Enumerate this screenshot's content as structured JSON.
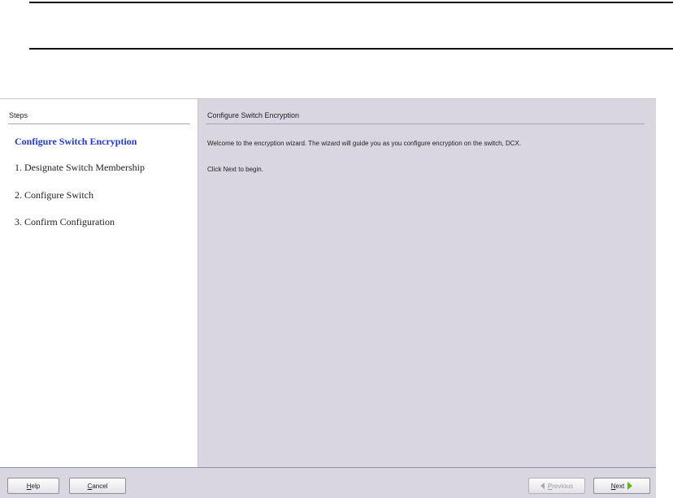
{
  "wizard": {
    "steps_header": "Steps",
    "steps": [
      "Configure Switch Encryption",
      "1. Designate Switch Membership",
      "2. Configure Switch",
      "3. Confirm Configuration"
    ],
    "content_title": "Configure Switch Encryption",
    "welcome_text": "Welcome to the encryption wizard. The wizard will guide you as you configure encryption on the switch, DCX.",
    "begin_text": "Click Next to begin."
  },
  "buttons": {
    "help": {
      "mnemonic": "H",
      "rest": "elp"
    },
    "cancel": {
      "mnemonic": "C",
      "rest": "ancel"
    },
    "previous": {
      "mnemonic": "P",
      "rest": "revious"
    },
    "next": {
      "mnemonic": "N",
      "rest": "ext"
    }
  },
  "icons": {
    "previous": "triangle-left-icon",
    "next": "triangle-right-icon"
  },
  "colors": {
    "current_step": "#2038d8",
    "next_arrow": "#69b21f",
    "window_bg": "#d9d6df"
  }
}
